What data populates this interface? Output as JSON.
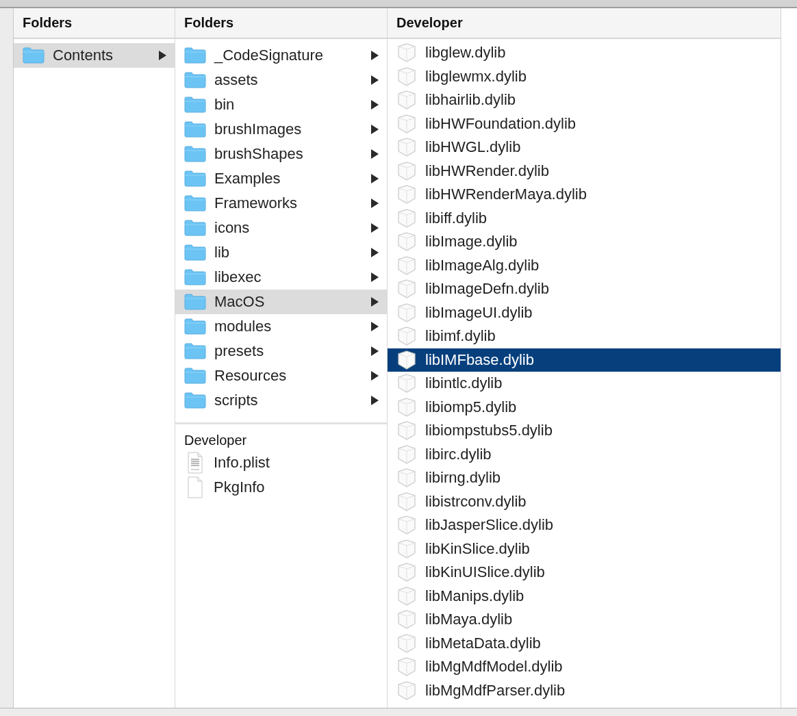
{
  "columns": [
    {
      "header": "Folders",
      "active": false,
      "items": [
        {
          "name": "Contents",
          "kind": "folder",
          "selected": true
        }
      ]
    },
    {
      "header": "Folders",
      "active": false,
      "items": [
        {
          "name": "_CodeSignature",
          "kind": "folder",
          "selected": false
        },
        {
          "name": "assets",
          "kind": "folder",
          "selected": false
        },
        {
          "name": "bin",
          "kind": "folder",
          "selected": false
        },
        {
          "name": "brushImages",
          "kind": "folder",
          "selected": false
        },
        {
          "name": "brushShapes",
          "kind": "folder",
          "selected": false
        },
        {
          "name": "Examples",
          "kind": "folder",
          "selected": false
        },
        {
          "name": "Frameworks",
          "kind": "folder",
          "selected": false
        },
        {
          "name": "icons",
          "kind": "folder",
          "selected": false
        },
        {
          "name": "lib",
          "kind": "folder",
          "selected": false
        },
        {
          "name": "libexec",
          "kind": "folder",
          "selected": false
        },
        {
          "name": "MacOS",
          "kind": "folder",
          "selected": true
        },
        {
          "name": "modules",
          "kind": "folder",
          "selected": false
        },
        {
          "name": "presets",
          "kind": "folder",
          "selected": false
        },
        {
          "name": "Resources",
          "kind": "folder",
          "selected": false
        },
        {
          "name": "scripts",
          "kind": "folder",
          "selected": false
        }
      ],
      "section": {
        "title": "Developer",
        "items": [
          {
            "name": "Info.plist",
            "kind": "plist",
            "selected": false
          },
          {
            "name": "PkgInfo",
            "kind": "document",
            "selected": false
          }
        ]
      }
    },
    {
      "header": "Developer",
      "active": true,
      "items": [
        {
          "name": "libglew.dylib",
          "kind": "library",
          "selected": false
        },
        {
          "name": "libglewmx.dylib",
          "kind": "library",
          "selected": false
        },
        {
          "name": "libhairlib.dylib",
          "kind": "library",
          "selected": false
        },
        {
          "name": "libHWFoundation.dylib",
          "kind": "library",
          "selected": false
        },
        {
          "name": "libHWGL.dylib",
          "kind": "library",
          "selected": false
        },
        {
          "name": "libHWRender.dylib",
          "kind": "library",
          "selected": false
        },
        {
          "name": "libHWRenderMaya.dylib",
          "kind": "library",
          "selected": false
        },
        {
          "name": "libiff.dylib",
          "kind": "library",
          "selected": false
        },
        {
          "name": "libImage.dylib",
          "kind": "library",
          "selected": false
        },
        {
          "name": "libImageAlg.dylib",
          "kind": "library",
          "selected": false
        },
        {
          "name": "libImageDefn.dylib",
          "kind": "library",
          "selected": false
        },
        {
          "name": "libImageUI.dylib",
          "kind": "library",
          "selected": false
        },
        {
          "name": "libimf.dylib",
          "kind": "library",
          "selected": false
        },
        {
          "name": "libIMFbase.dylib",
          "kind": "library",
          "selected": true
        },
        {
          "name": "libintlc.dylib",
          "kind": "library",
          "selected": false
        },
        {
          "name": "libiomp5.dylib",
          "kind": "library",
          "selected": false
        },
        {
          "name": "libiompstubs5.dylib",
          "kind": "library",
          "selected": false
        },
        {
          "name": "libirc.dylib",
          "kind": "library",
          "selected": false
        },
        {
          "name": "libirng.dylib",
          "kind": "library",
          "selected": false
        },
        {
          "name": "libistrconv.dylib",
          "kind": "library",
          "selected": false
        },
        {
          "name": "libJasperSlice.dylib",
          "kind": "library",
          "selected": false
        },
        {
          "name": "libKinSlice.dylib",
          "kind": "library",
          "selected": false
        },
        {
          "name": "libKinUISlice.dylib",
          "kind": "library",
          "selected": false
        },
        {
          "name": "libManips.dylib",
          "kind": "library",
          "selected": false
        },
        {
          "name": "libMaya.dylib",
          "kind": "library",
          "selected": false
        },
        {
          "name": "libMetaData.dylib",
          "kind": "library",
          "selected": false
        },
        {
          "name": "libMgMdfModel.dylib",
          "kind": "library",
          "selected": false
        },
        {
          "name": "libMgMdfParser.dylib",
          "kind": "library",
          "selected": false
        }
      ]
    }
  ]
}
